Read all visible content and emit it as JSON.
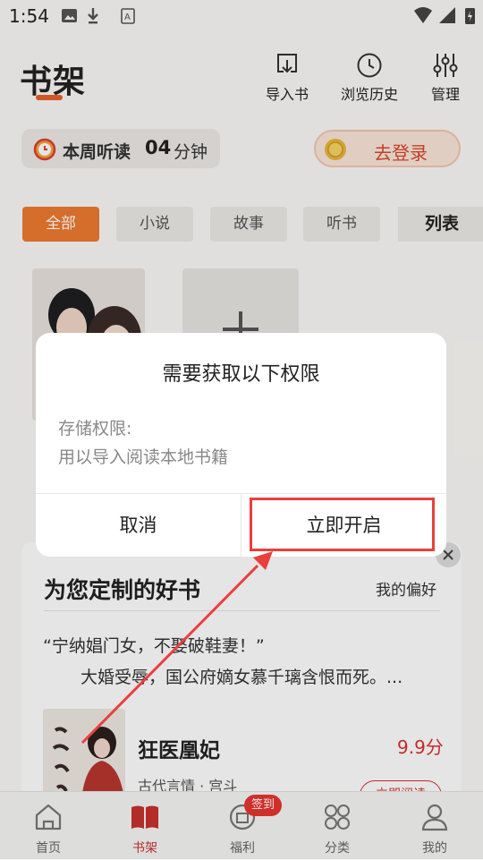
{
  "status_bar": {
    "time": "1:54"
  },
  "header": {
    "title": "书架",
    "import_label": "导入书",
    "history_label": "浏览历史",
    "manage_label": "管理"
  },
  "listen": {
    "label": "本周听读",
    "minutes": "04",
    "unit": "分钟"
  },
  "login": {
    "label": "去登录"
  },
  "filters": {
    "all": "全部",
    "novel": "小说",
    "story": "故事",
    "audio": "听书",
    "list_toggle": "列表"
  },
  "recommend": {
    "title": "为您定制的好书",
    "preference": "我的偏好",
    "quote": "“宁纳娼门女，不娶破鞋妻！”",
    "description": "大婚受辱，国公府嫡女慕千璃含恨而死。...",
    "book_title": "狂医凰妃",
    "score": "9.9分",
    "tags": "古代言情 · 宫斗",
    "read_button": "立即阅读"
  },
  "nav": {
    "home": "首页",
    "shelf": "书架",
    "welfare": "福利",
    "checkin_badge": "签到",
    "category": "分类",
    "mine": "我的"
  },
  "dialog": {
    "title": "需要获取以下权限",
    "permission": "存储权限:",
    "purpose": "用以导入阅读本地书籍",
    "cancel": "取消",
    "confirm": "立即开启"
  },
  "colors": {
    "accent": "#ee7a30",
    "brand_red": "#d8322c",
    "highlight": "#e8403c"
  }
}
